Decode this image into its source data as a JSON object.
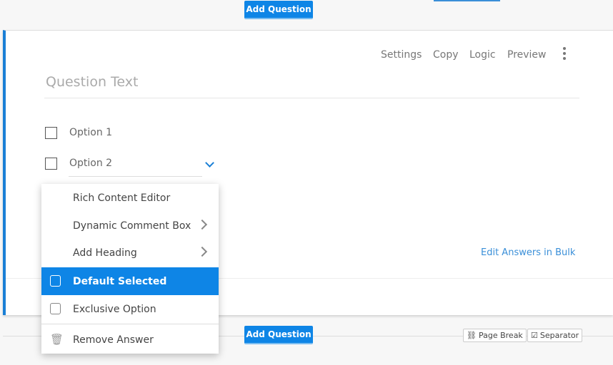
{
  "add_question_label": "Add Question",
  "toolbar": {
    "settings": "Settings",
    "copy": "Copy",
    "logic": "Logic",
    "preview": "Preview"
  },
  "question": {
    "placeholder": "Question Text",
    "options": [
      "Option 1",
      "Option 2"
    ]
  },
  "edit_bulk": "Edit Answers in Bulk",
  "menu": {
    "items": [
      "Rich Content Editor",
      "Dynamic Comment Box",
      "Add Heading",
      "Default Selected",
      "Exclusive Option",
      "Remove Answer"
    ]
  },
  "footer": {
    "page_break": "Page Break",
    "separator": "Separator"
  },
  "colors": {
    "accent": "#0e85e6"
  }
}
